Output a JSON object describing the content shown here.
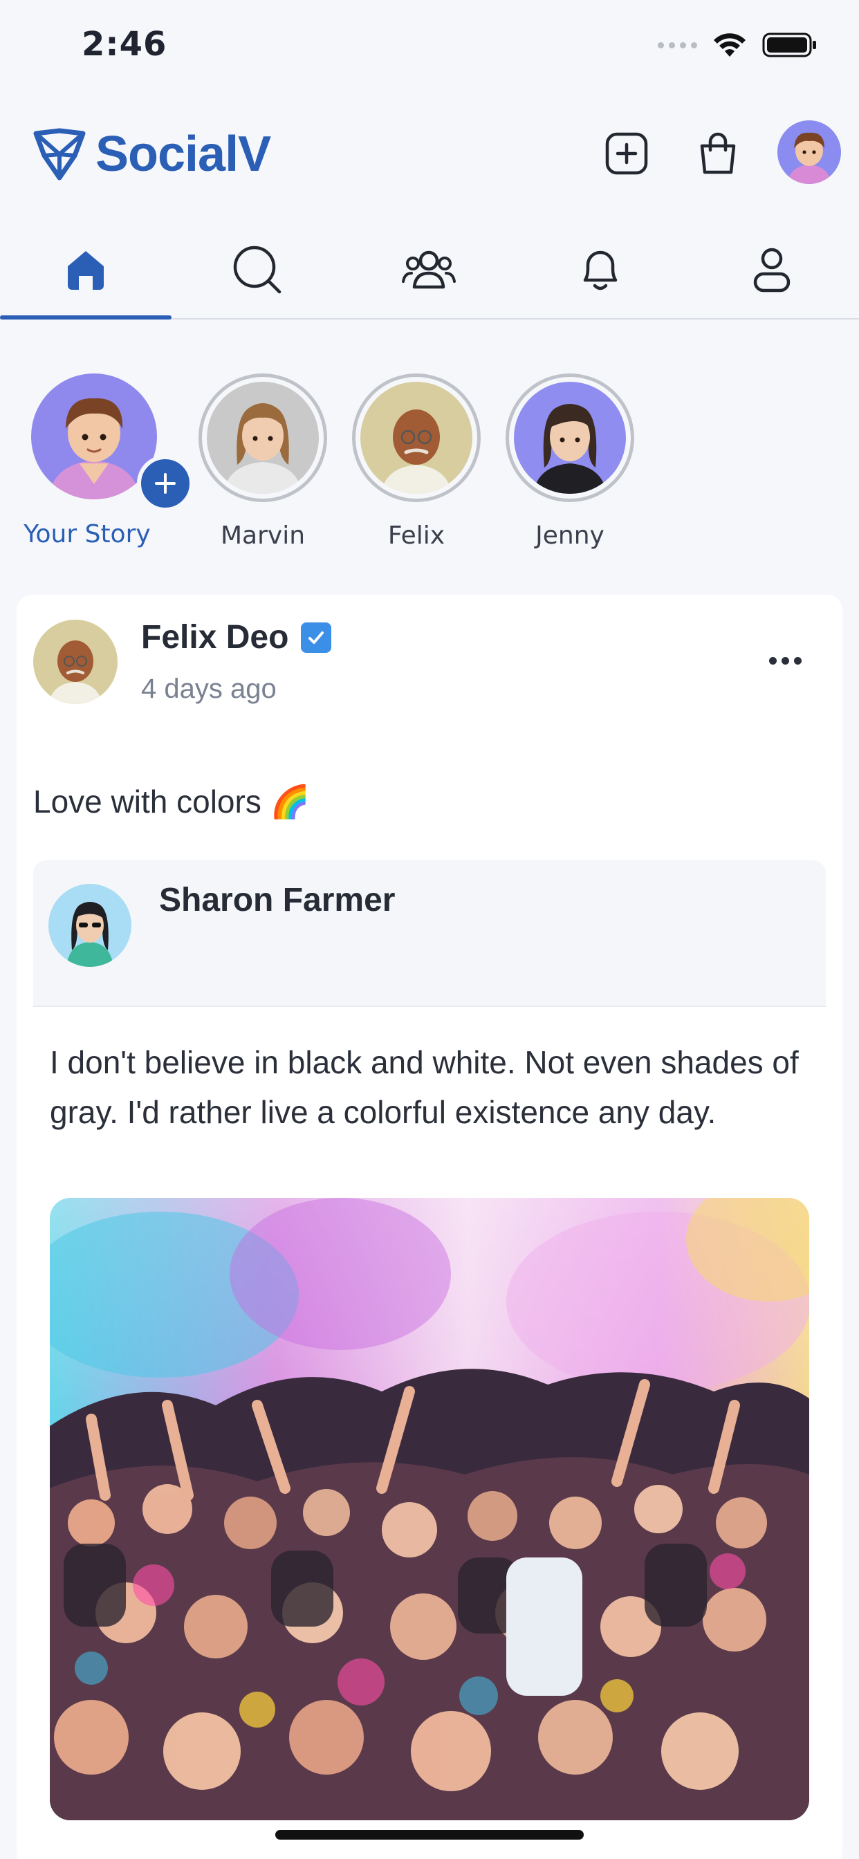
{
  "status_bar": {
    "time": "2:46"
  },
  "header": {
    "app_name": "SocialV"
  },
  "nav": {
    "tabs": [
      {
        "name": "home",
        "active": true
      },
      {
        "name": "search",
        "active": false
      },
      {
        "name": "groups",
        "active": false
      },
      {
        "name": "notifications",
        "active": false
      },
      {
        "name": "profile",
        "active": false
      }
    ]
  },
  "stories": {
    "your_story_label": "Your Story",
    "items": [
      {
        "name": "Marvin"
      },
      {
        "name": "Felix"
      },
      {
        "name": "Jenny"
      }
    ]
  },
  "post": {
    "author": "Felix Deo",
    "verified": true,
    "time_ago": "4 days ago",
    "caption": "Love with colors 🌈",
    "shared": {
      "author": "Sharon Farmer",
      "text": "I don't believe in black and white. Not even shades of gray. I'd rather live a colorful existence any day."
    }
  },
  "colors": {
    "accent": "#2b5fb6",
    "background": "#f5f7fa",
    "verified": "#3b8fe6"
  }
}
